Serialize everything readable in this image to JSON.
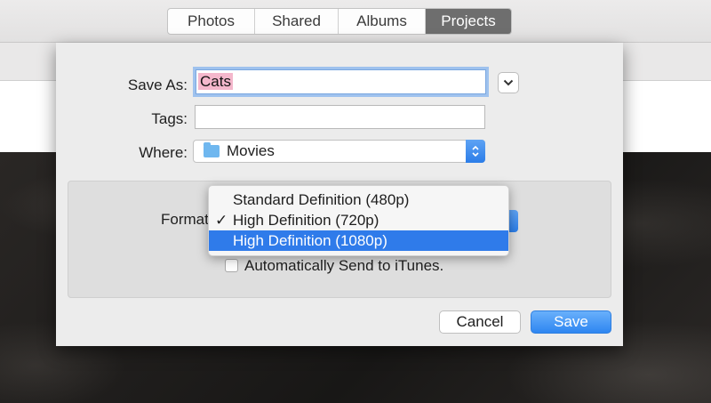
{
  "tabs": [
    {
      "label": "Photos",
      "active": false
    },
    {
      "label": "Shared",
      "active": false
    },
    {
      "label": "Albums",
      "active": false
    },
    {
      "label": "Projects",
      "active": true
    }
  ],
  "dialog": {
    "save_as_label": "Save As:",
    "save_as_value": "Cats",
    "tags_label": "Tags:",
    "tags_value": "",
    "where_label": "Where:",
    "where_value": "Movies",
    "format_label": "Format",
    "auto_send_label": "Automatically Send to iTunes.",
    "auto_send_checked": false,
    "cancel_label": "Cancel",
    "save_label": "Save"
  },
  "format_menu": {
    "items": [
      {
        "label": "Standard Definition (480p)",
        "checked": false,
        "highlighted": false
      },
      {
        "label": "High Definition (720p)",
        "checked": true,
        "highlighted": false
      },
      {
        "label": "High Definition (1080p)",
        "checked": false,
        "highlighted": true
      }
    ],
    "check_glyph": "✓"
  },
  "colors": {
    "accent": "#2f7bea",
    "selection_text_bg": "#f4b7cc",
    "active_tab": "#6e6e6e"
  },
  "icons": [
    "chevron-down-icon",
    "folder-icon",
    "popup-arrows-icon",
    "checkmark-icon"
  ]
}
